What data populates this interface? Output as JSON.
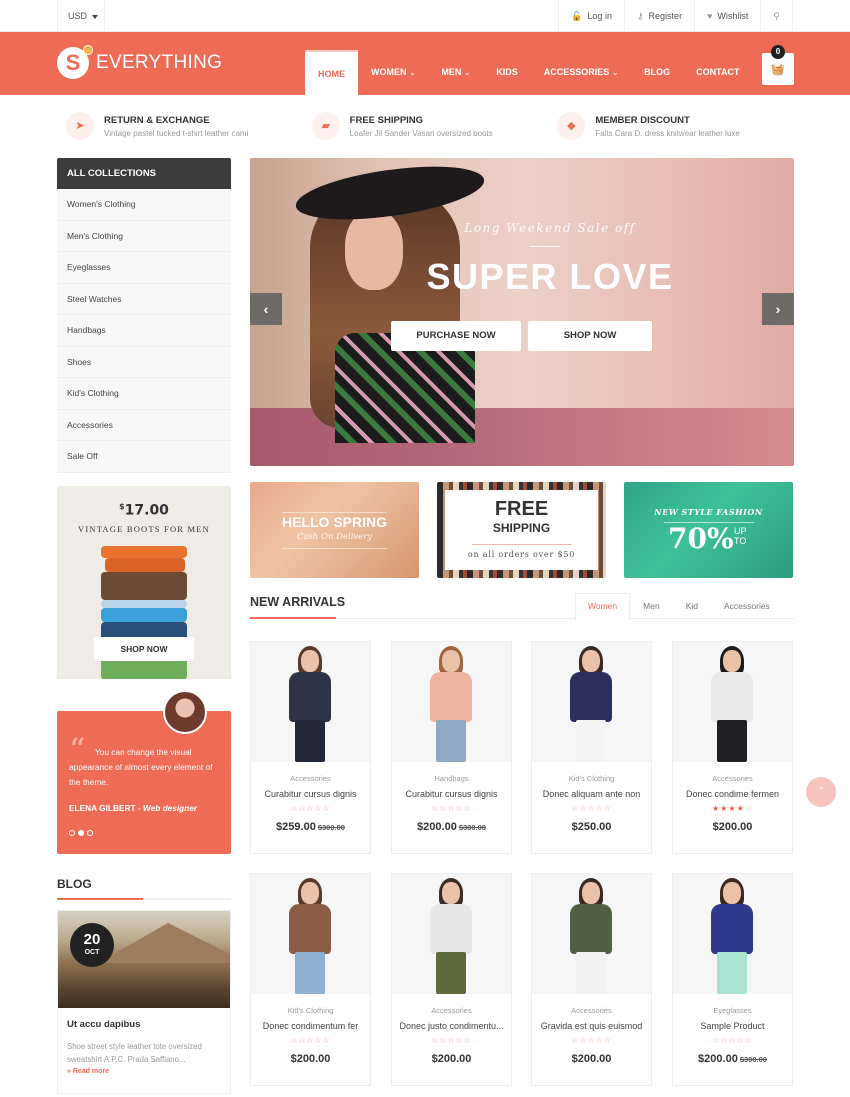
{
  "topbar": {
    "currency": "USD",
    "links": [
      {
        "icon": "lock-icon",
        "glyph": "🔓",
        "label": "Log in"
      },
      {
        "icon": "key-icon",
        "glyph": "⚷",
        "label": "Register"
      },
      {
        "icon": "heart-icon",
        "glyph": "♥",
        "label": "Wishlist"
      }
    ],
    "search_glyph": "⚲"
  },
  "header": {
    "logo_letter": "S",
    "logo_text": "EVERYTHING",
    "nav": [
      {
        "label": "HOME",
        "active": true,
        "dropdown": false
      },
      {
        "label": "WOMEN",
        "active": false,
        "dropdown": true
      },
      {
        "label": "MEN",
        "active": false,
        "dropdown": true
      },
      {
        "label": "KIDS",
        "active": false,
        "dropdown": false
      },
      {
        "label": "ACCESSORIES",
        "active": false,
        "dropdown": true
      },
      {
        "label": "BLOG",
        "active": false,
        "dropdown": false
      },
      {
        "label": "CONTACT",
        "active": false,
        "dropdown": false
      }
    ],
    "cart_count": "0",
    "cart_glyph": "🧺",
    "brand_color": "#ee6b56"
  },
  "features": [
    {
      "icon": "paper-plane-icon",
      "glyph": "➤",
      "title": "RETURN & EXCHANGE",
      "subtitle": "Vintage pastel tucked t-shirt leather cami"
    },
    {
      "icon": "truck-icon",
      "glyph": "▰",
      "title": "FREE SHIPPING",
      "subtitle": "Loafer Jil Sander Vasari oversized boots"
    },
    {
      "icon": "tag-icon",
      "glyph": "◆",
      "title": "MEMBER DISCOUNT",
      "subtitle": "Falts Cara D. dress knitwear leather luxe"
    }
  ],
  "collections": {
    "title": "ALL COLLECTIONS",
    "items": [
      "Women's Clothing",
      "Men's Clothing",
      "Eyeglasses",
      "Steel Watches",
      "Handbags",
      "Shoes",
      "Kid's Clothing",
      "Accessories",
      "Sale Off"
    ]
  },
  "promo": {
    "currency_symbol": "$",
    "price": "17.00",
    "title": "VINTAGE BOOTS FOR MEN",
    "button": "SHOP NOW"
  },
  "testimonial": {
    "quote_mark": "“",
    "text": "You can change the visual appearance of almost every element of the theme.",
    "author": "ELENA GILBERT",
    "separator": " - ",
    "role": "Web designer",
    "active_dot": 1,
    "dots": 3
  },
  "blog": {
    "title": "BLOG",
    "post": {
      "day": "20",
      "month": "OCT",
      "title": "Ut accu dapibus",
      "excerpt": "Shoe street style leather tote oversized sweatshirt A.P.C. Prada Saffiano...",
      "read_more": "» Read more"
    }
  },
  "slider": {
    "subtitle": "Long Weekend Sale off",
    "title": "SUPER LOVE",
    "buttons": [
      "PURCHASE NOW",
      "SHOP NOW"
    ],
    "prev_glyph": "‹",
    "next_glyph": "›"
  },
  "banners": {
    "spring": {
      "title": "HELLO SPRING",
      "subtitle": "Cash On Delivery"
    },
    "shipping": {
      "title": "FREE",
      "subtitle": "SHIPPING",
      "note": "on all orders over $50"
    },
    "fashion": {
      "title": "NEW STYLE FASHION",
      "percent": "70%",
      "up": "UP",
      "to": "TO"
    }
  },
  "new_arrivals": {
    "title": "NEW ARRIVALS",
    "tabs": [
      {
        "label": "Women",
        "active": true
      },
      {
        "label": "Men",
        "active": false
      },
      {
        "label": "Kid",
        "active": false
      },
      {
        "label": "Accessories",
        "active": false
      }
    ],
    "products": [
      {
        "category": "Accessories",
        "name": "Curabitur cursus dignis",
        "rating": 0,
        "price": "$259.00",
        "old_price": "$300.00",
        "colors": [
          "#5a3a2a",
          "#2c3346",
          "#23283a"
        ]
      },
      {
        "category": "Handbags",
        "name": "Curabitur cursus dignis",
        "rating": 0,
        "price": "$200.00",
        "old_price": "$300.00",
        "colors": [
          "#a0653f",
          "#eeb4a2",
          "#8fa9c4"
        ]
      },
      {
        "category": "Kid's Clothing",
        "name": "Donec aliquam ante non",
        "rating": 0,
        "price": "$250.00",
        "old_price": "",
        "colors": [
          "#3a2a22",
          "#2b2f5c",
          "#f4f4f4"
        ]
      },
      {
        "category": "Accessories",
        "name": "Donec condime fermen",
        "rating": 4,
        "price": "$200.00",
        "old_price": "",
        "colors": [
          "#1c1c1c",
          "#e8e8e8",
          "#1f1f24"
        ]
      },
      {
        "category": "Kid's Clothing",
        "name": "Donec condimentum fer",
        "rating": 0,
        "price": "$200.00",
        "old_price": "",
        "colors": [
          "#5a3a2a",
          "#8a5c45",
          "#8fb0d0"
        ]
      },
      {
        "category": "Accessories",
        "name": "Donec justo condimentu...",
        "rating": 0,
        "price": "$200.00",
        "old_price": "",
        "colors": [
          "#3b2d22",
          "#e6e6e6",
          "#5d6b3c"
        ]
      },
      {
        "category": "Accessories",
        "name": "Gravida est quis euismod",
        "rating": 0,
        "price": "$200.00",
        "old_price": "",
        "colors": [
          "#3a2a1f",
          "#4f6142",
          "#f2f2f2"
        ]
      },
      {
        "category": "Eyeglasses",
        "name": "Sample Product",
        "rating": 0,
        "price": "$200.00",
        "old_price": "$300.00",
        "colors": [
          "#3a2a1f",
          "#2e3b8c",
          "#a9e3d1"
        ]
      }
    ]
  },
  "back_to_top_glyph": "⌃"
}
